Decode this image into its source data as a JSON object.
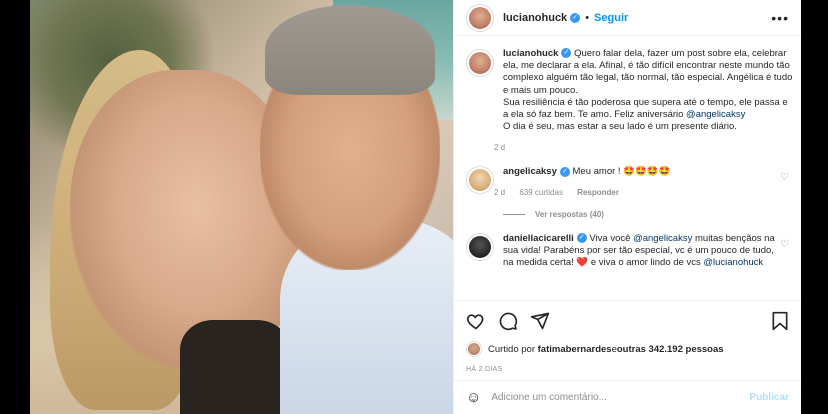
{
  "post": {
    "username": "lucianohuck",
    "follow_label": "Seguir",
    "separator": "•",
    "more_label": "•••"
  },
  "caption": {
    "username": "lucianohuck",
    "text_1": "Quero falar dela, fazer um post sobre ela, celebrar ela, me declarar a ela. Afinal, é tão difícil encontrar neste mundo tão complexo alguém tão legal, tão normal, tão especial. Angélica é tudo e mais um pouco.",
    "text_2": "Sua resiliência é tão poderosa que supera até o tempo, ele passa e a ela só faz bem. Te amo. Feliz aniversário ",
    "mention": "@angelicaksy",
    "text_3": "O dia é seu, mas estar a seu lado é um presente diário.",
    "age": "2 d"
  },
  "comments": [
    {
      "username": "angelicaksy",
      "text": "Meu amor ! 🤩🤩🤩🤩",
      "age": "2 d",
      "likes": "639 curtidas",
      "reply_label": "Responder",
      "view_replies": "Ver respostas (40)"
    },
    {
      "username": "daniellacicarelli",
      "text_1": "Viva você ",
      "mention_1": "@angelicaksy",
      "text_2": " muitas bençãos na sua vida! Parabéns por ser tão especial, vc é um pouco de tudo, na medida certa! ",
      "heart": "❤️",
      "text_3": " e viva o amor lindo de vcs ",
      "mention_2": "@lucianohuck"
    }
  ],
  "likes": {
    "prefix": "Curtido por ",
    "user": "fatimabernardes",
    "middle": " e ",
    "others": "outras 342.192 pessoas"
  },
  "timestamp": "HÁ 2 DIAS",
  "comment_box": {
    "placeholder": "Adicione um comentário...",
    "publish_label": "Publicar"
  },
  "colors": {
    "accent": "#0095f6",
    "verified": "#3897f0",
    "text": "#262626",
    "muted": "#8e8e8e"
  }
}
